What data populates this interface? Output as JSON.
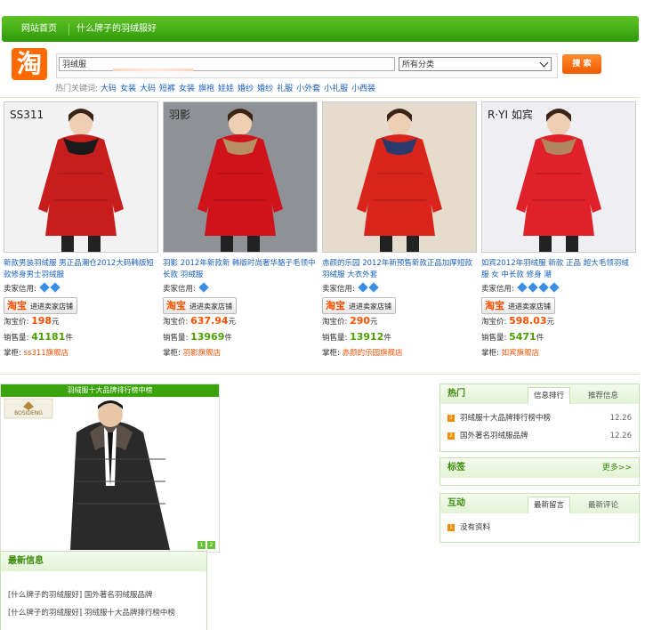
{
  "nav": {
    "home": "网站首页",
    "current": "什么牌子的羽绒服好"
  },
  "logo": {
    "text": "淘"
  },
  "search": {
    "value": "羽绒服",
    "category": "所有分类",
    "button": "搜 索"
  },
  "hot": {
    "label": "热门关键词:",
    "keywords": [
      "大码",
      "女装",
      "大码",
      "短裤",
      "女装",
      "旗袍",
      "娃娃",
      "婚纱",
      "婚纱",
      "礼服",
      "小外套",
      "小礼服",
      "小西装"
    ]
  },
  "products": [
    {
      "title": "新款男装羽绒服 男正品潮仓2012大码韩版短款修身男士羽绒服",
      "credit_label": "卖家信用:",
      "diamonds": 2,
      "shop_badge": "淘宝",
      "shop_text": "进进卖家店铺",
      "price_label": "淘宝价:",
      "price": "198",
      "price_unit": "元",
      "sales_label": "销售量:",
      "sales": "41181",
      "sales_unit": "件",
      "store_label": "掌柜:",
      "store": "ss311旗舰店",
      "img": {
        "bg": "#f2f2f2",
        "coat": "#c81d1d",
        "accent": "#1a1a1a",
        "brand": "SS311"
      }
    },
    {
      "title": "羽影 2012年新款新 韩版时尚奢华貉子毛领中长款 羽绒服",
      "credit_label": "卖家信用:",
      "diamonds": 1,
      "shop_badge": "淘宝",
      "shop_text": "进进卖家店铺",
      "price_label": "淘宝价:",
      "price": "637.94",
      "price_unit": "元",
      "sales_label": "销售量:",
      "sales": "13969",
      "sales_unit": "件",
      "store_label": "掌柜:",
      "store": "羽影旗舰店",
      "img": {
        "bg": "#8e9196",
        "coat": "#d0121b",
        "accent": "#b79062",
        "brand": "羽影"
      }
    },
    {
      "title": "赤颜的乐园 2012年新预售新款正品加厚短款羽绒服 大衣外套",
      "credit_label": "卖家信用:",
      "diamonds": 2,
      "shop_badge": "淘宝",
      "shop_text": "进进卖家店铺",
      "price_label": "淘宝价:",
      "price": "290",
      "price_unit": "元",
      "sales_label": "销售量:",
      "sales": "13912",
      "sales_unit": "件",
      "store_label": "掌柜:",
      "store": "赤颜的乐园旗舰店",
      "img": {
        "bg": "#e6dccd",
        "coat": "#d9241b",
        "accent": "#2b3a6b",
        "brand": ""
      }
    },
    {
      "title": "如宾2012年羽绒服 新款 正品 超大毛领羽绒服 女 中长款 修身 潮",
      "credit_label": "卖家信用:",
      "diamonds": 4,
      "shop_badge": "淘宝",
      "shop_text": "进进卖家店铺",
      "price_label": "淘宝价:",
      "price": "598.03",
      "price_unit": "元",
      "sales_label": "销售量:",
      "sales": "5471",
      "sales_unit": "件",
      "store_label": "掌柜:",
      "store": "如宾旗舰店",
      "img": {
        "bg": "#efeef3",
        "coat": "#e0212a",
        "accent": "#b08560",
        "brand": "R·YI 如宾"
      }
    }
  ],
  "banner": {
    "title": "羽绒服十大品牌排行榜中榜",
    "brand": "BOSIDENG",
    "pages": [
      "1",
      "2"
    ]
  },
  "hot_box": {
    "title": "热门",
    "tabs": [
      "信息排行",
      "推荐信息"
    ],
    "items": [
      {
        "num": "1",
        "text": "羽绒服十大品牌排行榜中榜",
        "date": "12.26"
      },
      {
        "num": "2",
        "text": "国外著名羽绒服品牌",
        "date": "12.26"
      }
    ]
  },
  "tag_box": {
    "title": "标签",
    "more": "更多>>"
  },
  "interact_box": {
    "title": "互动",
    "tabs": [
      "最新留言",
      "最新评论"
    ],
    "items": [
      {
        "num": "1",
        "text": "没有资料"
      }
    ]
  },
  "news": {
    "title": "最新信息",
    "items": [
      "[什么牌子的羽绒服好] 国外著名羽绒服品牌",
      "[什么牌子的羽绒服好] 羽绒服十大品牌排行榜中榜"
    ]
  },
  "colors": {
    "green": "#3aa20a",
    "orange": "#ff5000",
    "link": "#1a5fc0"
  }
}
